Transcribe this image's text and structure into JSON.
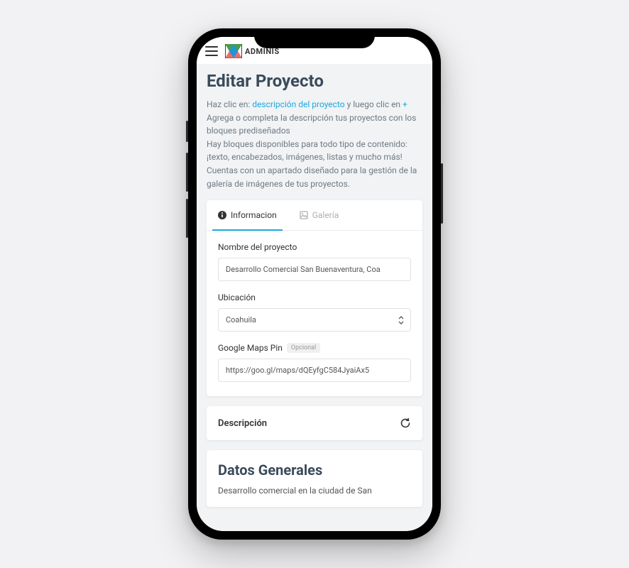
{
  "header": {
    "brand": "ADMINIS"
  },
  "page": {
    "title": "Editar Proyecto",
    "help_prefix": "Haz clic en: ",
    "help_link1": "descripción del proyecto",
    "help_mid": " y luego clic en ",
    "help_link2": "+",
    "help_line2": "Agrega o completa la descripción tus proyectos con los bloques prediseñados",
    "help_line3": "Hay bloques disponibles para todo tipo de contenido: ¡texto, encabezados, imágenes, listas y mucho más!",
    "help_line4": "Cuentas con un apartado diseñado para la gestión de la galería de imágenes de tus proyectos."
  },
  "tabs": {
    "information": "Informacion",
    "gallery": "Galería"
  },
  "form": {
    "name_label": "Nombre del proyecto",
    "name_value": "Desarrollo Comercial San Buenaventura, Coa",
    "location_label": "Ubicación",
    "location_value": "Coahuila",
    "mapspin_label": "Google Maps Pin",
    "mapspin_optional": "Opcional",
    "mapspin_value": "https://goo.gl/maps/dQEyfgC584JyaiAx5"
  },
  "description": {
    "title": "Descripción"
  },
  "generales": {
    "title": "Datos Generales",
    "text": "Desarrollo comercial en la ciudad de San"
  }
}
